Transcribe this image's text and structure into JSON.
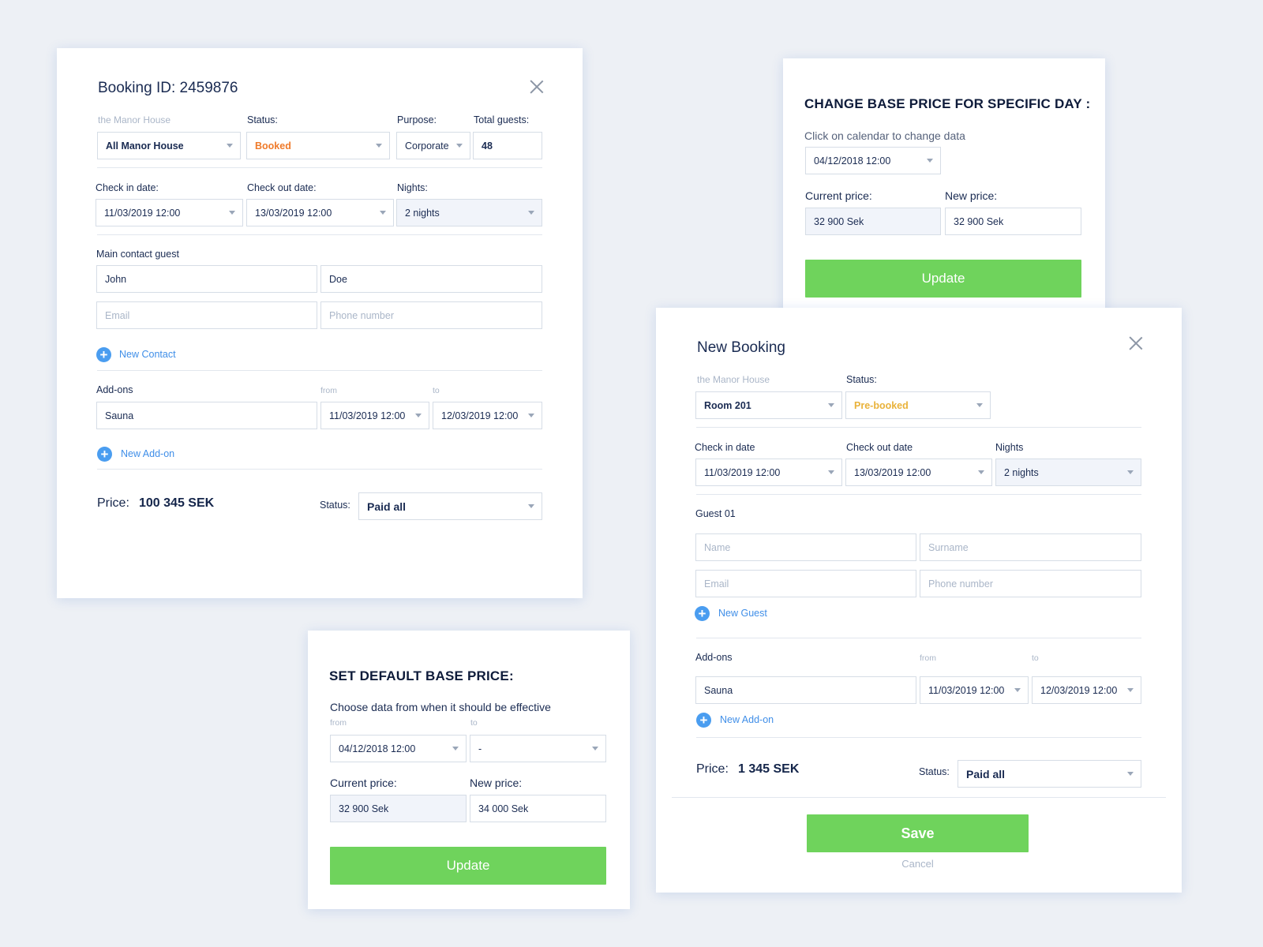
{
  "colors": {
    "background": "#edf0f5",
    "primary_text": "#14254a",
    "accent_blue": "#4a9df0",
    "update_green": "#6fd35c",
    "status_booked": "#ef7a2a",
    "status_prebooked": "#e9b23a",
    "muted": "#aab6c8"
  },
  "booking": {
    "title": "Booking ID: 2459876",
    "property_label": "the Manor House",
    "property_value": "All Manor House",
    "status_label": "Status:",
    "status_value": "Booked",
    "purpose_label": "Purpose:",
    "purpose_value": "Corporate",
    "guests_label": "Total guests:",
    "guests_value": "48",
    "checkin_label": "Check in date:",
    "checkin_value": "11/03/2019  12:00",
    "checkout_label": "Check out date:",
    "checkout_value": "13/03/2019  12:00",
    "nights_label": "Nights:",
    "nights_value": "2 nights",
    "contact_label": "Main contact guest",
    "first_name": "John",
    "last_name": "Doe",
    "email_placeholder": "Email",
    "phone_placeholder": "Phone number",
    "new_contact": "New Contact",
    "addons_label": "Add-ons",
    "from_label": "from",
    "to_label": "to",
    "addon_value": "Sauna",
    "addon_from": "11/03/2019  12:00",
    "addon_to": "12/03/2019  12:00",
    "new_addon": "New Add-on",
    "price_label": "Price:",
    "price_value": "100 345 SEK",
    "pay_status_label": "Status:",
    "pay_status_value": "Paid all",
    "close_icon": "close-icon"
  },
  "change_price": {
    "title": "CHANGE BASE PRICE FOR SPECIFIC DAY :",
    "hint": "Click on calendar to change data",
    "date_value": "04/12/2018  12:00",
    "current_label": "Current price:",
    "current_value": "32 900 Sek",
    "new_label": "New price:",
    "new_value": "32 900 Sek",
    "button": "Update"
  },
  "default_price": {
    "title": "SET DEFAULT BASE PRICE:",
    "hint": "Choose data from when it should be effective",
    "from_label": "from",
    "to_label": "to",
    "from_value": "04/12/2018  12:00",
    "to_value": "-",
    "current_label": "Current price:",
    "current_value": "32 900 Sek",
    "new_label": "New price:",
    "new_value": "34 000 Sek",
    "button": "Update"
  },
  "new_booking": {
    "title": "New Booking",
    "property_label": "the Manor House",
    "property_value": "Room 201",
    "status_label": "Status:",
    "status_value": "Pre-booked",
    "checkin_label": "Check in date",
    "checkin_value": "11/03/2019  12:00",
    "checkout_label": "Check out date",
    "checkout_value": "13/03/2019  12:00",
    "nights_label": "Nights",
    "nights_value": "2 nights",
    "guest_label": "Guest 01",
    "name_placeholder": "Name",
    "surname_placeholder": "Surname",
    "email_placeholder": "Email",
    "phone_placeholder": "Phone number",
    "new_guest": "New Guest",
    "addons_label": "Add-ons",
    "from_label": "from",
    "to_label": "to",
    "addon_value": "Sauna",
    "addon_from": "11/03/2019  12:00",
    "addon_to": "12/03/2019  12:00",
    "new_addon": "New Add-on",
    "price_label": "Price:",
    "price_value": "1 345 SEK",
    "pay_status_label": "Status:",
    "pay_status_value": "Paid all",
    "save_button": "Save",
    "cancel_button": "Cancel",
    "close_icon": "close-icon"
  }
}
